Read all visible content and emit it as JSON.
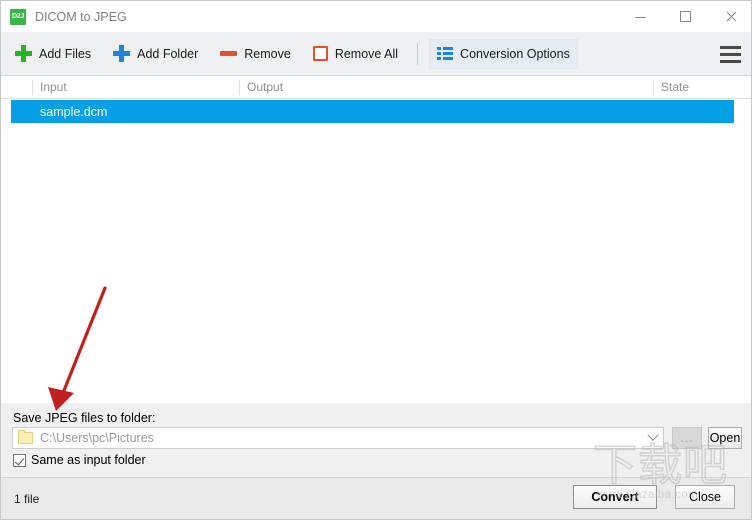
{
  "window": {
    "title": "DICOM to JPEG",
    "icon_label": "D2J",
    "icon_name": "app-icon",
    "controls": {
      "minimize": "minimize-icon",
      "maximize": "maximize-icon",
      "close": "close-icon"
    }
  },
  "toolbar": {
    "add_files": "Add Files",
    "add_folder": "Add Folder",
    "remove": "Remove",
    "remove_all": "Remove All",
    "conversion_options": "Conversion Options",
    "menu": "hamburger-menu-icon"
  },
  "file_list": {
    "columns": [
      "Input",
      "Output",
      "State"
    ],
    "rows": [
      {
        "input": "sample.dcm",
        "output": "",
        "state": "",
        "selected": true
      }
    ]
  },
  "output_panel": {
    "label": "Save JPEG files to folder:",
    "folder_path": "C:\\Users\\pc\\Pictures",
    "browse_button": "...",
    "open_button": "Open",
    "same_as_input": {
      "label": "Same as input folder",
      "checked": true
    }
  },
  "status_bar": {
    "file_count": "1 file",
    "convert_button": "Convert",
    "close_button": "Close"
  },
  "watermark": {
    "chars": "下载吧",
    "url": "www.xiazaiba.com"
  },
  "colors": {
    "selection_blue": "#059fe6",
    "add_files_green": "#23b61e",
    "add_folder_blue": "#1a86e0",
    "remove_orange": "#e0522a",
    "annotation_red": "#c0211f",
    "app_icon_green": "#3cb54a"
  }
}
